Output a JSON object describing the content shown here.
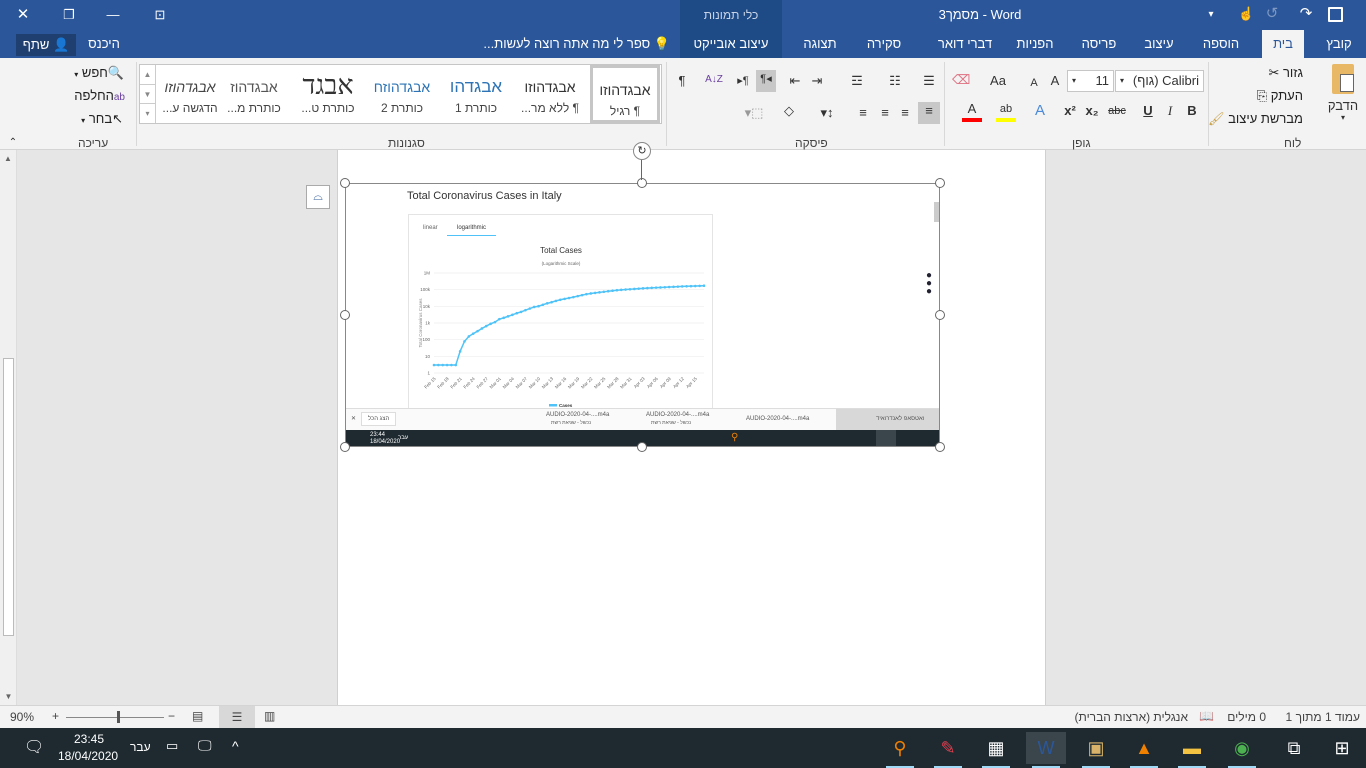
{
  "titlebar": {
    "title": "מסמך3 - Word",
    "context_group": "כלי תמונות",
    "close": "✕",
    "restore": "❐",
    "minimize": "—",
    "ribbon_options": "⊡",
    "save_icon": "save-icon",
    "undo": "↺",
    "redo": "↷"
  },
  "tabs": [
    "קובץ",
    "בית",
    "הוספה",
    "עיצוב",
    "פריסה",
    "הפניות",
    "דברי דואר",
    "סקירה",
    "תצוגה",
    "עיצוב אובייקט"
  ],
  "active_tab": "בית",
  "tell_me": "ספר לי מה אתה רוצה לעשות...",
  "sign_in": "היכנס",
  "share": "שתף",
  "clipboard": {
    "label": "לוח",
    "paste": "הדבק",
    "cut": "גזור",
    "copy": "העתק",
    "format_painter": "מברשת עיצוב"
  },
  "font": {
    "label": "גופן",
    "name": "Calibri (גוף)",
    "size": "11",
    "bold": "B",
    "italic": "I",
    "underline": "U",
    "strike": "abc",
    "sub": "x₂",
    "sup": "x²",
    "change_case": "Aa",
    "grow": "A",
    "shrink": "A",
    "effects": "A",
    "font_color": "A",
    "font_color_value": "#ff0000",
    "highlight_value": "#ffff00"
  },
  "paragraph": {
    "label": "פיסקה",
    "pilcrow": "¶",
    "sort": "A↓Z"
  },
  "styles": {
    "label": "סגנונות",
    "items": [
      {
        "preview": "אבגדהוזו",
        "name": "¶ רגיל"
      },
      {
        "preview": "אבגדהוזו",
        "name": "¶ ללא מר..."
      },
      {
        "preview": "אבגדהו",
        "name": "כותרת 1"
      },
      {
        "preview": "אבגדהוזח",
        "name": "כותרת 2"
      },
      {
        "preview": "אבגד",
        "name": "כותרת ט..."
      },
      {
        "preview": "אבגדהוז",
        "name": "כותרת מ..."
      },
      {
        "preview": "אבגדהוזו",
        "name": "הדגשה ע..."
      }
    ]
  },
  "editing": {
    "label": "עריכה",
    "find": "חפש",
    "replace": "החלפה",
    "select": "בחר"
  },
  "status": {
    "page": "עמוד 1 מתוך 1",
    "words": "0 מילים",
    "language": "אנגלית (ארצות הברית)",
    "zoom": "90%",
    "zoom_percent": 90
  },
  "taskbar": {
    "time": "23:45",
    "date": "18/04/2020",
    "lang": "עבר",
    "apps": [
      "search-app",
      "pdf-app",
      "calculator-app",
      "word-app",
      "photos-app",
      "vlc-app",
      "file-explorer-app",
      "chrome-app"
    ]
  },
  "embedded": {
    "page_title": "Total Coronavirus Cases in Italy",
    "tab_linear": "linear",
    "tab_log": "logarithmic",
    "downloads": [
      {
        "name": "AUDIO-2020-04-....m4a",
        "sub": "נכשל - שגיאת רשת"
      },
      {
        "name": "AUDIO-2020-04-....m4a",
        "sub": "נכשל - שגיאת רשת"
      },
      {
        "name": "AUDIO-2020-04-....m4a",
        "sub": ""
      },
      {
        "name": "ואטסאפ לאנדרואיד",
        "sub": ""
      }
    ],
    "show_all": "הצג הכל",
    "tb_time": "23:44",
    "tb_date": "18/04/2020",
    "tb_lang": "עבר"
  },
  "chart_data": {
    "type": "line",
    "title": "Total Cases",
    "subtitle": "(Logarithmic Scale)",
    "ylabel": "Total Coronavirus Cases",
    "legend": "Cases",
    "legend_position": "bottom",
    "yscale": "log",
    "ylim": [
      1,
      1000000
    ],
    "grid": true,
    "color": "#4fc3f7",
    "yticks": [
      "1",
      "10",
      "100",
      "1k",
      "10k",
      "100k",
      "1M"
    ],
    "xticks": [
      "Feb 15",
      "Feb 18",
      "Feb 21",
      "Feb 24",
      "Feb 27",
      "Mar 01",
      "Mar 04",
      "Mar 07",
      "Mar 10",
      "Mar 13",
      "Mar 16",
      "Mar 19",
      "Mar 22",
      "Mar 25",
      "Mar 28",
      "Mar 31",
      "Apr 03",
      "Apr 06",
      "Apr 09",
      "Apr 12",
      "Apr 15"
    ],
    "x_start": "Feb 15",
    "values": [
      3,
      3,
      3,
      3,
      3,
      3,
      20,
      79,
      157,
      229,
      323,
      470,
      655,
      889,
      1128,
      1694,
      2036,
      2502,
      3089,
      3858,
      4636,
      5883,
      7375,
      9172,
      10149,
      12462,
      15113,
      17660,
      21157,
      24747,
      27980,
      31506,
      35713,
      41035,
      47021,
      53578,
      59138,
      63927,
      69176,
      74386,
      80589,
      86498,
      92472,
      97689,
      101739,
      105792,
      110574,
      115242,
      119827,
      124632,
      128948,
      132547,
      135586,
      139422,
      143626,
      147577,
      152271,
      156363,
      159516,
      162488,
      165155,
      168941,
      172434
    ]
  }
}
